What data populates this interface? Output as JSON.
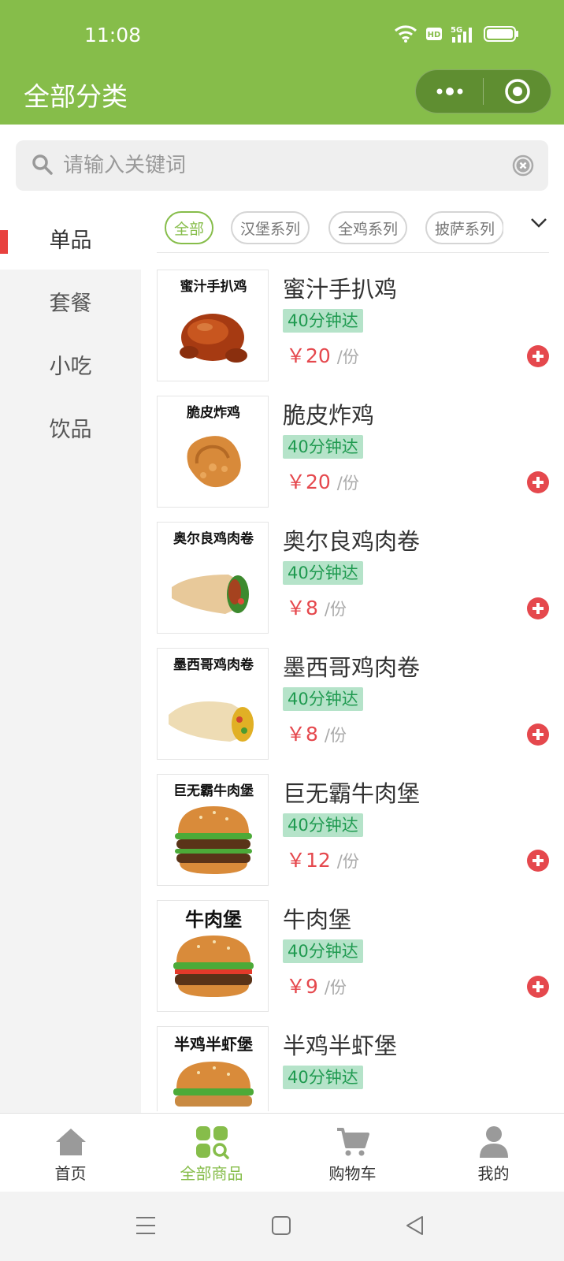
{
  "status_bar": {
    "time": "11:08"
  },
  "nav": {
    "title": "全部分类"
  },
  "search": {
    "placeholder": "请输入关键词"
  },
  "sidebar": {
    "items": [
      {
        "label": "单品",
        "active": true
      },
      {
        "label": "套餐"
      },
      {
        "label": "小吃"
      },
      {
        "label": "饮品"
      }
    ]
  },
  "tags": [
    {
      "label": "全部",
      "active": true
    },
    {
      "label": "汉堡系列"
    },
    {
      "label": "全鸡系列"
    },
    {
      "label": "披萨系列"
    }
  ],
  "products": [
    {
      "thumb_title": "蜜汁手扒鸡",
      "name": "蜜汁手扒鸡",
      "badge": "40分钟达",
      "price": "￥20",
      "unit": "/份",
      "image": "roast-chicken"
    },
    {
      "thumb_title": "脆皮炸鸡",
      "name": "脆皮炸鸡",
      "badge": "40分钟达",
      "price": "￥20",
      "unit": "/份",
      "image": "fried-chicken"
    },
    {
      "thumb_title": "奥尔良鸡肉卷",
      "name": "奥尔良鸡肉卷",
      "badge": "40分钟达",
      "price": "￥8",
      "unit": "/份",
      "image": "chicken-wrap"
    },
    {
      "thumb_title": "墨西哥鸡肉卷",
      "name": "墨西哥鸡肉卷",
      "badge": "40分钟达",
      "price": "￥8",
      "unit": "/份",
      "image": "mexican-wrap"
    },
    {
      "thumb_title": "巨无霸牛肉堡",
      "name": "巨无霸牛肉堡",
      "badge": "40分钟达",
      "price": "￥12",
      "unit": "/份",
      "image": "double-burger"
    },
    {
      "thumb_title": "牛肉堡",
      "name": "牛肉堡",
      "badge": "40分钟达",
      "price": "￥9",
      "unit": "/份",
      "image": "beef-burger"
    },
    {
      "thumb_title": "半鸡半虾堡",
      "name": "半鸡半虾堡",
      "badge": "40分钟达",
      "price": "",
      "unit": "",
      "image": "chicken-shrimp-burger"
    }
  ],
  "tabbar": {
    "items": [
      {
        "label": "首页",
        "icon": "home-icon"
      },
      {
        "label": "全部商品",
        "icon": "grid-search-icon",
        "active": true
      },
      {
        "label": "购物车",
        "icon": "cart-icon"
      },
      {
        "label": "我的",
        "icon": "user-icon"
      }
    ]
  },
  "colors": {
    "brand_green": "#86bd4a",
    "price_red": "#e5484d",
    "badge_bg": "#b5e3c9",
    "badge_text": "#1f9a50"
  }
}
